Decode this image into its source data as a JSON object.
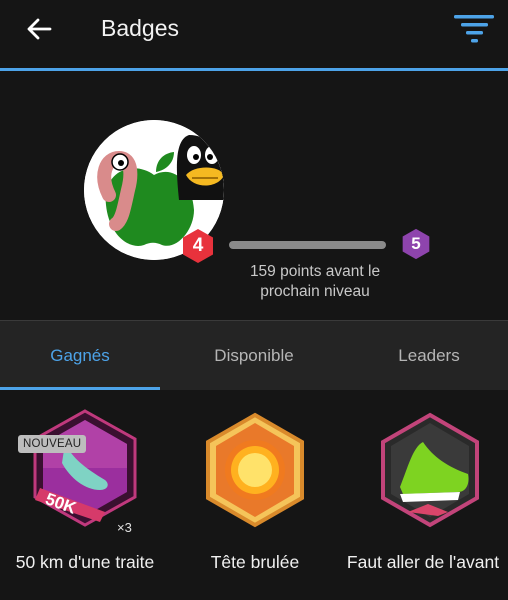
{
  "header": {
    "title": "Badges",
    "back_icon": "arrow-left-icon",
    "filter_icon": "filter-icon",
    "accent": "#4da3e8"
  },
  "profile": {
    "current_level": "4",
    "next_level": "5",
    "current_level_color": "#e8323c",
    "next_level_color": "#8e44ad",
    "progress": 0.0,
    "points_text": "159 points avant le prochain niveau"
  },
  "tabs": [
    {
      "label": "Gagnés",
      "active": true
    },
    {
      "label": "Disponible",
      "active": false
    },
    {
      "label": "Leaders",
      "active": false
    }
  ],
  "badges": [
    {
      "name": "50 km d'une traite",
      "tag": "NOUVEAU",
      "label": "50K",
      "multiplier": "×3",
      "icon": "running-shoe-50k-badge"
    },
    {
      "name": "Tête brulée",
      "icon": "sun-badge"
    },
    {
      "name": "Faut aller de l'avant",
      "icon": "sneaker-badge"
    }
  ]
}
